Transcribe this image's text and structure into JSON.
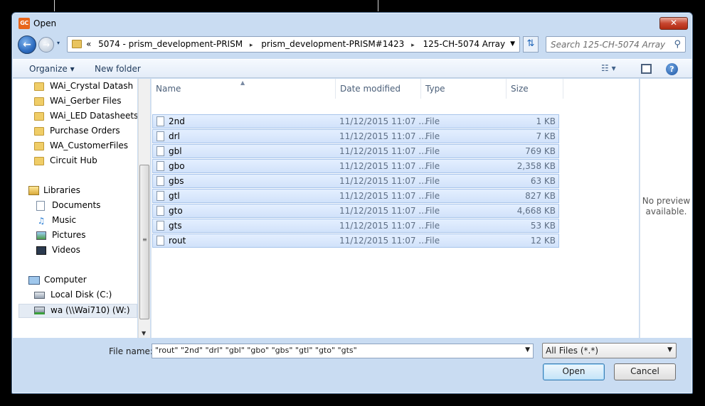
{
  "window": {
    "title": "Open",
    "app_icon_text": "GC",
    "close_symbol": "✕"
  },
  "nav": {
    "recent_symbol": "▾",
    "breadcrumbs": [
      "«",
      "5074 - prism_development-PRISM",
      "▸",
      "prism_development-PRISM#1423",
      "▸",
      "125-CH-5074 Array"
    ],
    "search_placeholder": "Search 125-CH-5074 Array"
  },
  "toolbar": {
    "organize": "Organize ▾",
    "new_folder": "New folder",
    "view_icon": "☷ ▾",
    "help": "?"
  },
  "sidebar": {
    "items": [
      {
        "label": "WAi_Crystal Datash",
        "icon": "folder-icon"
      },
      {
        "label": "WAi_Gerber Files",
        "icon": "folder-icon"
      },
      {
        "label": "WAi_LED Datasheets",
        "icon": "folder-icon"
      },
      {
        "label": "Purchase Orders",
        "icon": "folder-icon"
      },
      {
        "label": "WA_CustomerFiles",
        "icon": "folder-icon"
      },
      {
        "label": "Circuit Hub",
        "icon": "folder-icon"
      },
      {
        "label": "Libraries",
        "icon": "library-icon"
      },
      {
        "label": "Documents",
        "icon": "documents-icon"
      },
      {
        "label": "Music",
        "icon": "music-icon"
      },
      {
        "label": "Pictures",
        "icon": "pictures-icon"
      },
      {
        "label": "Videos",
        "icon": "videos-icon"
      },
      {
        "label": "Computer",
        "icon": "computer-icon"
      },
      {
        "label": "Local Disk (C:)",
        "icon": "disk-icon"
      },
      {
        "label": "wa (\\\\Wai710) (W:)",
        "icon": "network-drive-icon"
      }
    ]
  },
  "columns": {
    "name": "Name",
    "date": "Date modified",
    "type": "Type",
    "size": "Size"
  },
  "files": [
    {
      "name": "2nd",
      "date": "11/12/2015 11:07 ...",
      "type": "File",
      "size": "1 KB"
    },
    {
      "name": "drl",
      "date": "11/12/2015 11:07 ...",
      "type": "File",
      "size": "7 KB"
    },
    {
      "name": "gbl",
      "date": "11/12/2015 11:07 ...",
      "type": "File",
      "size": "769 KB"
    },
    {
      "name": "gbo",
      "date": "11/12/2015 11:07 ...",
      "type": "File",
      "size": "2,358 KB"
    },
    {
      "name": "gbs",
      "date": "11/12/2015 11:07 ...",
      "type": "File",
      "size": "63 KB"
    },
    {
      "name": "gtl",
      "date": "11/12/2015 11:07 ...",
      "type": "File",
      "size": "827 KB"
    },
    {
      "name": "gto",
      "date": "11/12/2015 11:07 ...",
      "type": "File",
      "size": "4,668 KB"
    },
    {
      "name": "gts",
      "date": "11/12/2015 11:07 ...",
      "type": "File",
      "size": "53 KB"
    },
    {
      "name": "rout",
      "date": "11/12/2015 11:07 ...",
      "type": "File",
      "size": "12 KB"
    }
  ],
  "preview": {
    "line1": "No preview",
    "line2": "available."
  },
  "footer": {
    "file_name_label": "File name:",
    "file_name_value": "\"rout\" \"2nd\" \"drl\" \"gbl\" \"gbo\" \"gbs\" \"gtl\" \"gto\" \"gts\"",
    "filter_value": "All Files (*.*)",
    "open_label": "Open",
    "cancel_label": "Cancel"
  },
  "colors": {
    "selection": "#d1e2fa",
    "window_frame": "#c9dcf2",
    "accent": "#2d6cc0"
  }
}
